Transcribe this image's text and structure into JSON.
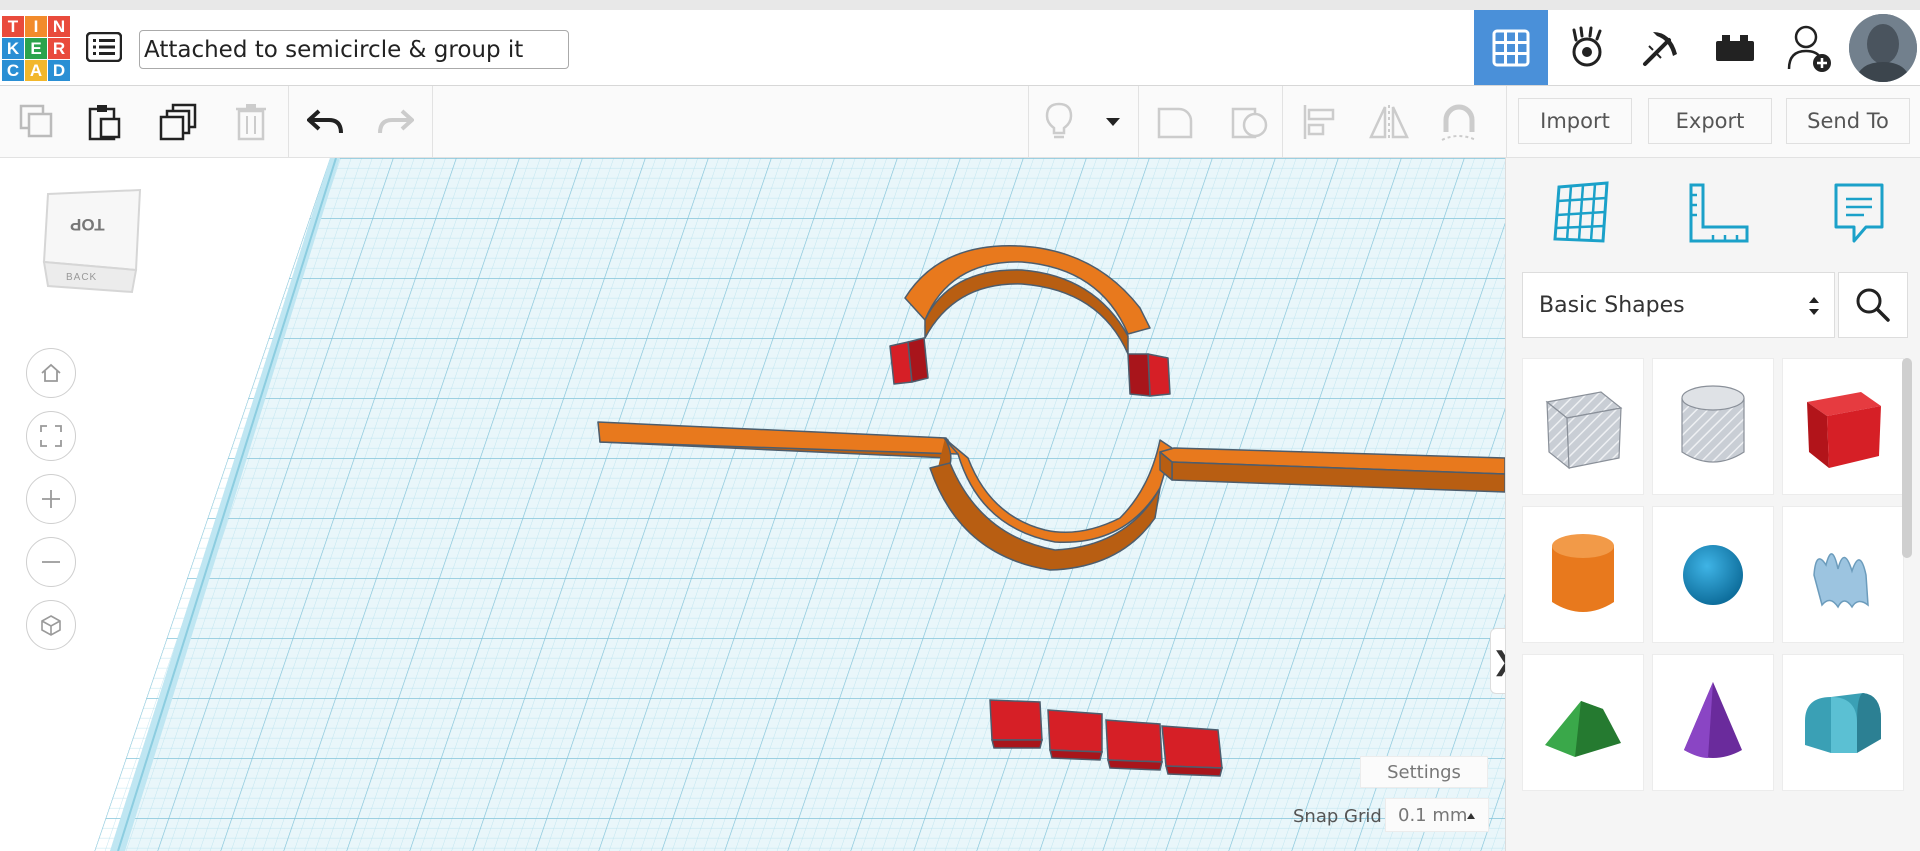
{
  "app": {
    "logo_letters": [
      "T",
      "I",
      "N",
      "K",
      "E",
      "R",
      "C",
      "A",
      "D"
    ],
    "design_title": "Attached to semicircle & group it"
  },
  "header": {
    "nav": [
      {
        "name": "3d-design",
        "icon": "grid-icon",
        "active": true
      },
      {
        "name": "blocks",
        "icon": "hand-claw-icon",
        "active": false
      },
      {
        "name": "bricks",
        "icon": "pickaxe-icon",
        "active": false
      },
      {
        "name": "lego",
        "icon": "brick-icon",
        "active": false
      },
      {
        "name": "invite",
        "icon": "add-user-icon",
        "active": false
      }
    ]
  },
  "toolbar": {
    "import_label": "Import",
    "export_label": "Export",
    "send_to_label": "Send To"
  },
  "viewport": {
    "view_cube_top": "TOP",
    "view_cube_front": "BACK",
    "settings_label": "Settings",
    "snap_grid_label": "Snap Grid",
    "snap_grid_value": "0.1 mm"
  },
  "panel": {
    "category": "Basic Shapes",
    "shapes": [
      {
        "name": "box-hole",
        "color": "#b8bec7"
      },
      {
        "name": "cylinder-hole",
        "color": "#c7ccd2"
      },
      {
        "name": "box",
        "color": "#d61f26"
      },
      {
        "name": "cylinder",
        "color": "#e97a1c"
      },
      {
        "name": "sphere",
        "color": "#1b8fc4"
      },
      {
        "name": "scribble",
        "color": "#8ab6d6"
      },
      {
        "name": "roof",
        "color": "#2e9a3a"
      },
      {
        "name": "cone",
        "color": "#6a2b9c"
      },
      {
        "name": "round-roof",
        "color": "#3aa0b5"
      }
    ]
  },
  "colors": {
    "accent": "#4a90d9",
    "grid": "#9fd4e6",
    "orange": "#e8791d",
    "red": "#d61f26"
  }
}
